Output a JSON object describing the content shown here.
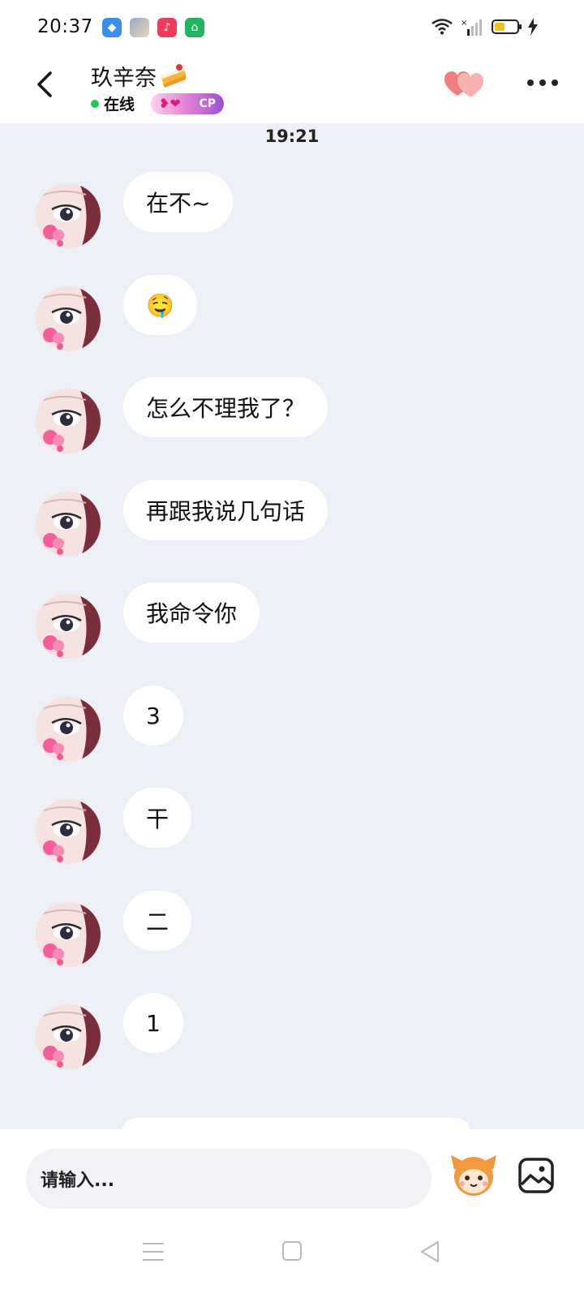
{
  "status_bar": {
    "time": "20:37",
    "app_icons": [
      "browser-icon",
      "anime-app-icon",
      "music-app-icon",
      "store-app-icon"
    ]
  },
  "header": {
    "contact_name": "玖辛奈",
    "status": "在线",
    "badge": "CP"
  },
  "chat": {
    "timestamp": "19:21",
    "messages": [
      {
        "text": "在不~"
      },
      {
        "text": "🤤"
      },
      {
        "text": "怎么不理我了？"
      },
      {
        "text": "再跟我说几句话"
      },
      {
        "text": "我命令你"
      },
      {
        "text": "3"
      },
      {
        "text": "干"
      },
      {
        "text": "二"
      },
      {
        "text": "1"
      }
    ]
  },
  "composer": {
    "placeholder": "请输入..."
  },
  "colors": {
    "online": "#22c55e",
    "chat_background": "#eef0f7",
    "bubble": "#ffffff",
    "heart": "#f08a8a"
  }
}
